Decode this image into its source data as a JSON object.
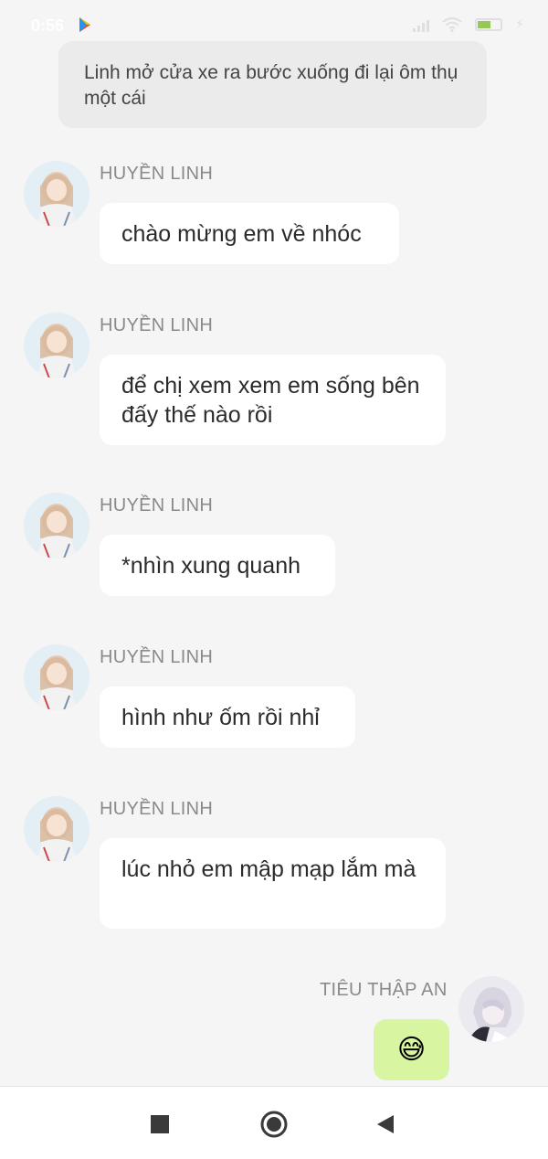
{
  "status_bar": {
    "time": "0:56",
    "battery_level": "6"
  },
  "narration": {
    "text": "Linh mở cửa xe ra bước xuống đi lại ôm thụ một cái"
  },
  "messages": [
    {
      "sender": "HUYỀN LINH",
      "text": "chào mừng em về nhóc"
    },
    {
      "sender": "HUYỀN LINH",
      "text": "để chị xem xem em sống bên đấy thế nào rồi"
    },
    {
      "sender": "HUYỀN LINH",
      "text": "*nhìn xung quanh"
    },
    {
      "sender": "HUYỀN LINH",
      "text": "hình như ốm rồi nhỉ"
    },
    {
      "sender": "HUYỀN LINH",
      "text": "lúc nhỏ em mập mạp lắm mà"
    }
  ],
  "my_message": {
    "sender": "TIÊU THẬP AN",
    "emoji": "😅"
  },
  "nav": {
    "recent_icon": "square-icon",
    "home_icon": "circle-icon",
    "back_icon": "triangle-back-icon"
  },
  "colors": {
    "background": "#f5f5f5",
    "bubble_other": "#ffffff",
    "bubble_mine": "#d8f5a2",
    "narration_bg": "#ebebeb",
    "sender_name": "#8a8a8a"
  }
}
